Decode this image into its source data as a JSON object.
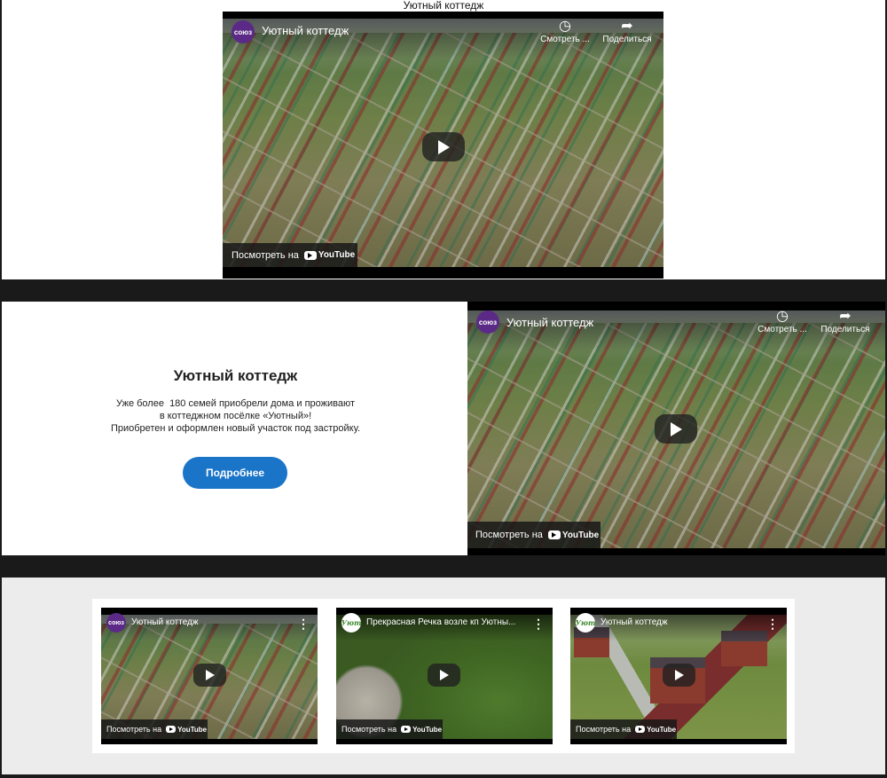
{
  "section_top": {
    "heading": "Уютный коттедж",
    "player": {
      "channel_logo_text": "союз",
      "title": "Уютный коттедж",
      "watch_later_label": "Смотреть ...",
      "share_label": "Поделиться",
      "watch_on_label": "Посмотреть на",
      "youtube_label": "YouTube"
    }
  },
  "section_hero": {
    "title": "Уютный коттедж",
    "text_lines": [
      "Уже более  180 семей приобрели дома и проживают",
      "в коттеджном посёлке «Уютный»!",
      "Приобретен и оформлен новый участок под застройку."
    ],
    "button_label": "Подробнее",
    "player": {
      "channel_logo_text": "союз",
      "title": "Уютный коттедж",
      "watch_later_label": "Смотреть ...",
      "share_label": "Поделиться",
      "watch_on_label": "Посмотреть на",
      "youtube_label": "YouTube"
    }
  },
  "gallery": {
    "videos": [
      {
        "channel_logo_text": "союз",
        "title": "Уютный коттедж",
        "watch_on_label": "Посмотреть на",
        "youtube_label": "YouTube"
      },
      {
        "channel_logo_text": "Уют",
        "title": "Прекрасная Речка возле кп Уютны...",
        "watch_on_label": "Посмотреть на",
        "youtube_label": "YouTube"
      },
      {
        "channel_logo_text": "Уют",
        "title": "Уютный коттедж",
        "watch_on_label": "Посмотреть на",
        "youtube_label": "YouTube"
      }
    ]
  },
  "colors": {
    "accent_button": "#1a74c8",
    "channel_souz": "#5b2a86",
    "gallery_background": "#ececec"
  },
  "icons": [
    "clock-icon",
    "share-arrow-icon",
    "play-icon",
    "youtube-icon",
    "kebab-menu-icon"
  ]
}
